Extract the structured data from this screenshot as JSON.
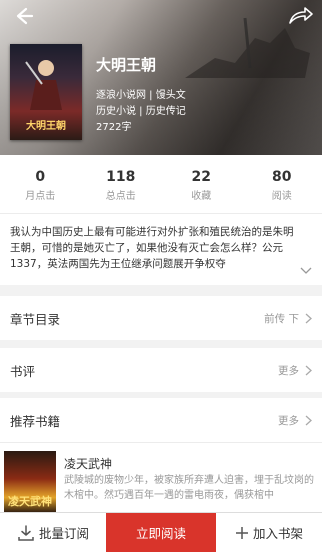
{
  "nav": {
    "back_icon": "back-arrow-icon",
    "share_icon": "share-icon"
  },
  "book": {
    "cover_text": "大明王朝",
    "title": "大明王朝",
    "source": "逐浪小说网 | 馒头文",
    "category": "历史小说 | 历史传记",
    "word_count": "2722字"
  },
  "stats": [
    {
      "value": "0",
      "label": "月点击"
    },
    {
      "value": "118",
      "label": "总点击"
    },
    {
      "value": "22",
      "label": "收藏"
    },
    {
      "value": "80",
      "label": "阅读"
    }
  ],
  "description": "我认为中国历史上最有可能进行对外扩张和殖民统治的是朱明王朝，可惜的是她灭亡了，如果他没有灭亡会怎么样？公元1337，英法两国先为王位继承问题展开争权夺",
  "sections": {
    "toc": {
      "title": "章节目录",
      "right": "前传 下"
    },
    "review": {
      "title": "书评",
      "right": "更多"
    },
    "recommend": {
      "title": "推荐书籍",
      "right": "更多"
    }
  },
  "recommended": {
    "cover_text": "凌天武神",
    "title": "凌天武神",
    "desc": "武陵城的废物少年，被家族所弃遭人迫害，埋于乱坟岗的木棺中。然巧遇百年一遇的雷电雨夜，偶获棺中"
  },
  "bottom": {
    "batch_label": "批量订阅",
    "read_label": "立即阅读",
    "shelf_label": "加入书架"
  },
  "colors": {
    "accent": "#d9342b"
  }
}
